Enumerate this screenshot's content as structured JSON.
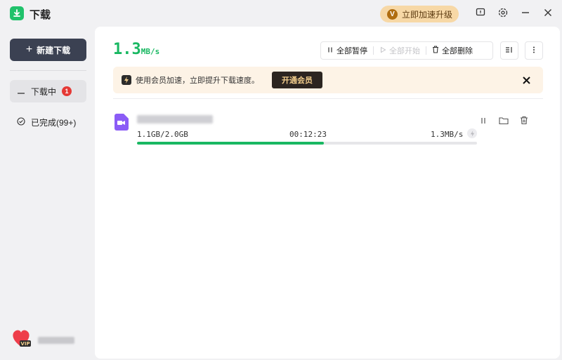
{
  "app": {
    "title": "下载"
  },
  "header": {
    "upgrade_label": "立即加速升级",
    "upgrade_badge": "V"
  },
  "sidebar": {
    "new_download_label": "新建下载",
    "items": [
      {
        "label": "下载中",
        "badge": "1",
        "active": true
      },
      {
        "label": "已完成(99+)",
        "active": false
      }
    ]
  },
  "main": {
    "speed_value": "1.3",
    "speed_unit": "MB/s",
    "toolbar": {
      "pause_all": "全部暂停",
      "start_all": "全部开始",
      "delete_all": "全部删除"
    },
    "banner": {
      "text": "使用会员加速，立即提升下载速度。",
      "button": "开通会员"
    },
    "task": {
      "size_progress": "1.1GB/2.0GB",
      "time_remaining": "00:12:23",
      "speed": "1.3MB/s",
      "progress_fraction": 0.55
    }
  },
  "colors": {
    "accent": "#19b862",
    "sidebar_button": "#3b4152",
    "banner_bg": "#fdf3e6",
    "vip_button": "#2b2520"
  }
}
